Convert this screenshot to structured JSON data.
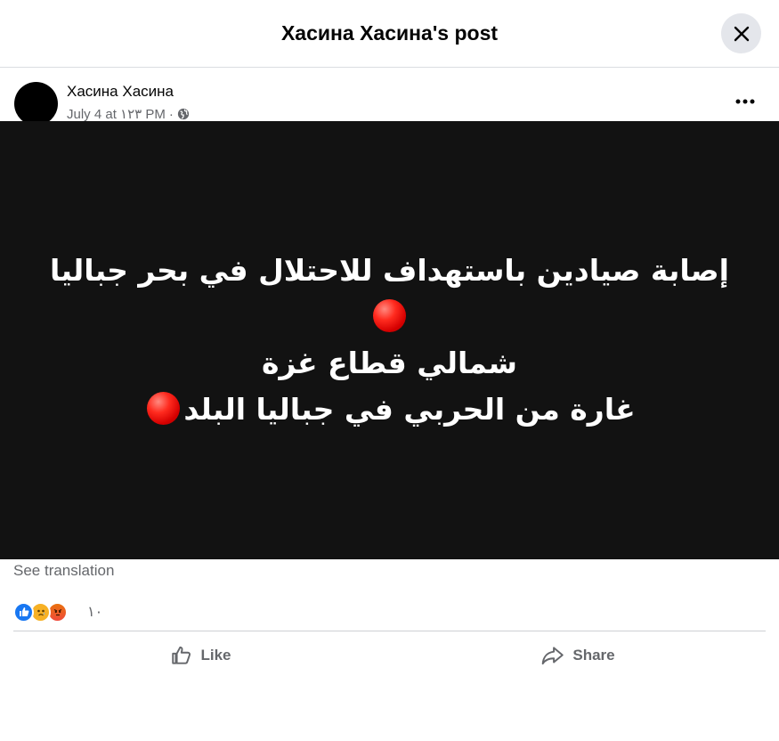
{
  "header": {
    "title": "Хасина Хасина's post"
  },
  "post": {
    "author": "Хасина Хасина",
    "timestamp": "July 4 at ١٢٣ PM",
    "separator": "·",
    "image_text": {
      "line1": "إصابة صيادين باستهداف للاحتلال في بحر جباليا",
      "line2": "شمالي قطاع غزة",
      "line3": "غارة من الحربي في جباليا البلد"
    },
    "see_translation": "See translation",
    "reaction_count": "١٠"
  },
  "actions": {
    "like": "Like",
    "share": "Share"
  },
  "icons": {
    "close": "close-icon",
    "more": "more-icon",
    "globe": "globe-icon",
    "like": "thumbs-up-icon",
    "share": "share-icon"
  },
  "colors": {
    "image_bg": "#121212",
    "like_blue": "#1877f2",
    "muted": "#65676b"
  }
}
